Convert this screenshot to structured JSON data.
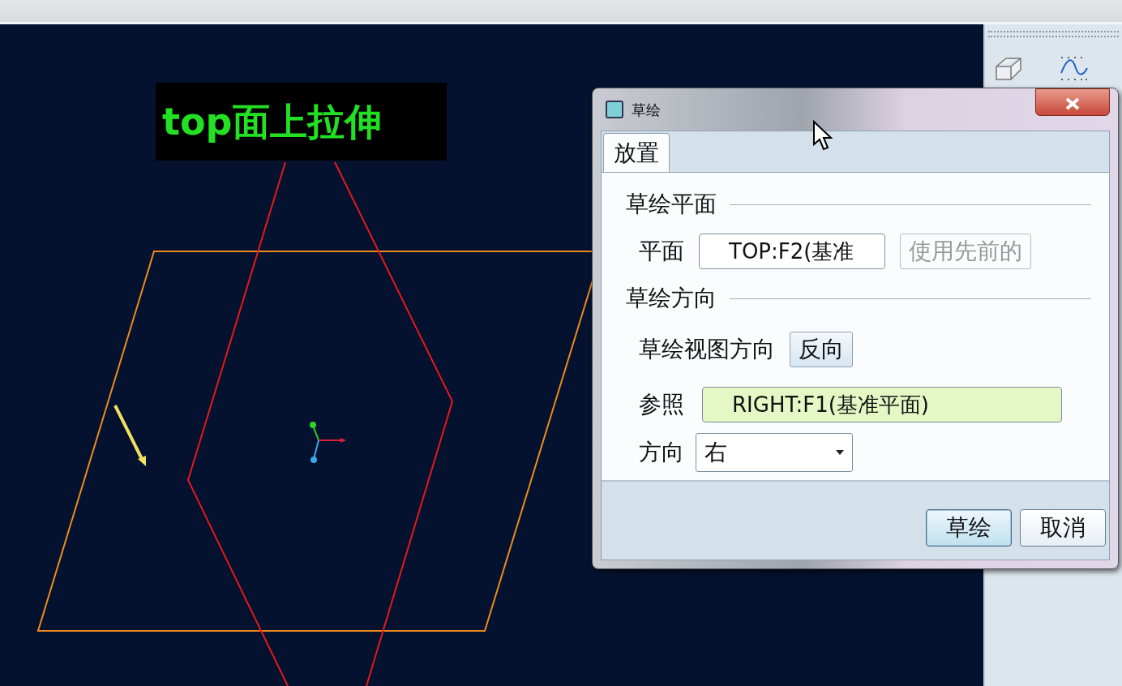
{
  "overlay_label": "top面上拉伸",
  "dialog": {
    "title": "草绘",
    "tabs": [
      {
        "label": "放置",
        "selected": true
      }
    ],
    "plane_section": "草绘平面",
    "plane_label": "平面",
    "plane_value": "TOP:F2(基准",
    "use_previous_button": {
      "label": "使用先前的",
      "disabled": true
    },
    "orientation_section": "草绘方向",
    "view_direction_label": "草绘视图方向",
    "flip_button": "反向",
    "reference_label": "参照",
    "reference_value": "RIGHT:F1(基准平面)",
    "reference_active": true,
    "direction_label": "方向",
    "direction_value": "右",
    "buttons": [
      {
        "label": "草绘",
        "default": true
      },
      {
        "label": "取消",
        "default": false
      }
    ]
  }
}
